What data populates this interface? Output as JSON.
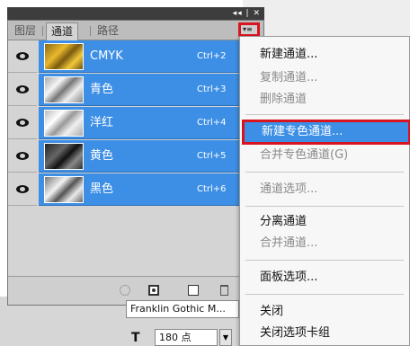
{
  "panel": {
    "tabs": [
      "图层",
      "通道",
      "路径"
    ],
    "active_tab": "通道",
    "collapse_ctrl": "◂◂ | ✕",
    "menu_button_icon": "▾≡",
    "channels": [
      {
        "name": "CMYK",
        "shortcut": "Ctrl+2",
        "thumb": "t-cmyk"
      },
      {
        "name": "青色",
        "shortcut": "Ctrl+3",
        "thumb": "t-cyan"
      },
      {
        "name": "洋红",
        "shortcut": "Ctrl+4",
        "thumb": "t-mag"
      },
      {
        "name": "黄色",
        "shortcut": "Ctrl+5",
        "thumb": "t-yel"
      },
      {
        "name": "黑色",
        "shortcut": "Ctrl+6",
        "thumb": "t-blk"
      }
    ]
  },
  "character": {
    "font": "Franklin Gothic M...",
    "size_icon": "T",
    "size": "180 点"
  },
  "menu": {
    "items": [
      {
        "label": "新建通道...",
        "disabled": false
      },
      {
        "label": "复制通道...",
        "disabled": true
      },
      {
        "label": "删除通道",
        "disabled": true
      },
      {
        "label": "新建专色通道...",
        "highlighted": true
      },
      {
        "label": "合并专色通道(G)",
        "disabled": true
      },
      {
        "label": "通道选项...",
        "disabled": true
      },
      {
        "label": "分离通道",
        "disabled": false
      },
      {
        "label": "合并通道...",
        "disabled": true
      },
      {
        "label": "面板选项...",
        "disabled": false
      },
      {
        "label": "关闭",
        "disabled": false
      },
      {
        "label": "关闭选项卡组",
        "disabled": false
      }
    ]
  },
  "colors": {
    "selection_blue": "#3d8fe6",
    "highlight_red": "#d8141e"
  }
}
